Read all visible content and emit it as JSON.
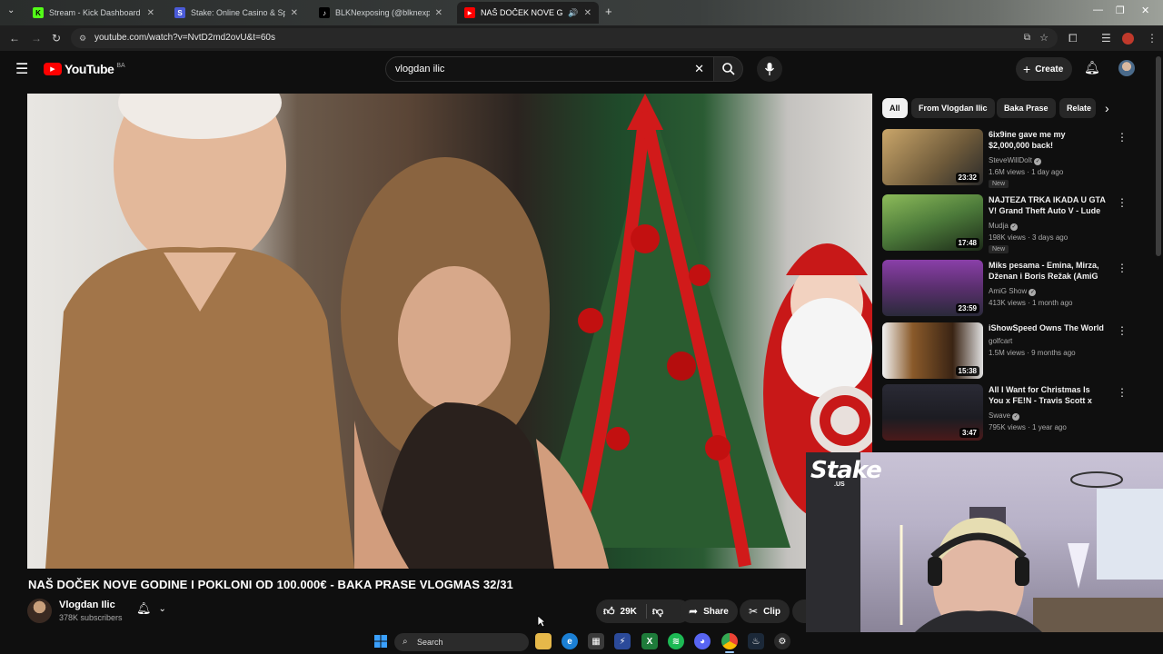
{
  "browser": {
    "tabs": [
      {
        "label": "Stream - Kick Dashboard",
        "icon": "kick-icon",
        "color": "#53fc18"
      },
      {
        "label": "Stake: Online Casino & Sports",
        "icon": "stake-icon",
        "color": "#6b7cff"
      },
      {
        "label": "BLKNexposing (@blknexposing)",
        "icon": "tiktok-icon",
        "color": "#111111"
      },
      {
        "label": "NAŠ DOČEK NOVE GODINE",
        "icon": "youtube-icon",
        "color": "#ff0000",
        "active": true
      }
    ],
    "url": "youtube.com/watch?v=NvtD2md2ovU&t=60s"
  },
  "youtube": {
    "logo_text": "YouTube",
    "region": "BA",
    "search_value": "vlogdan ilic",
    "create_label": "Create"
  },
  "video": {
    "title": "NAŠ DOČEK NOVE GODINE I POKLONI OD 100.000€ - BAKA PRASE VLOGMAS 32/31",
    "channel": "Vlogdan Ilic",
    "subscribers": "378K subscribers",
    "likes": "29K",
    "share_label": "Share",
    "clip_label": "Clip"
  },
  "sidebar": {
    "chips": [
      "All",
      "From Vlogdan Ilic",
      "Baka Prase",
      "Relate"
    ],
    "items": [
      {
        "title": "6ix9ine gave me my $2,000,000 back!",
        "channel": "SteveWillDoIt",
        "verified": true,
        "meta": "1.6M views · 1 day ago",
        "badge": "New",
        "duration": "23:32",
        "thumb": "#6e5a3a"
      },
      {
        "title": "NAJTEZA TRKA IKADA U GTA V! Grand Theft Auto V - Lude ...",
        "channel": "Mudja",
        "verified": true,
        "meta": "198K views · 3 days ago",
        "badge": "New",
        "duration": "17:48",
        "thumb": "#4c7a3a"
      },
      {
        "title": "Miks pesama - Emina, Mirza, Dženan i Boris Režak (AmiG ...",
        "channel": "AmiG Show",
        "verified": true,
        "meta": "413K views · 1 month ago",
        "badge": "",
        "duration": "23:59",
        "thumb": "#5a2f6e"
      },
      {
        "title": "iShowSpeed Owns The World",
        "channel": "golfcart",
        "verified": false,
        "meta": "1.5M views · 9 months ago",
        "badge": "",
        "duration": "15:38",
        "thumb": "#8a5a2a"
      },
      {
        "title": "All I Want for Christmas Is You x FE!N - Travis Scott x Mariah ...",
        "channel": "Swave",
        "verified": true,
        "meta": "795K views · 1 year ago",
        "badge": "",
        "duration": "3:47",
        "thumb": "#1c1c22"
      }
    ]
  },
  "overlay": {
    "logo": "Stake",
    "logo_sub": ".US"
  },
  "taskbar": {
    "search_label": "Search"
  }
}
